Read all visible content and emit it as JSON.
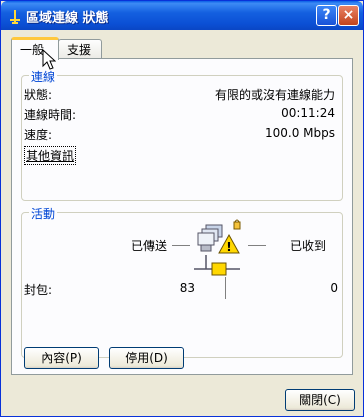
{
  "window": {
    "title": "區域連線 狀態",
    "help_glyph": "?",
    "close_glyph": "×"
  },
  "tabs": [
    {
      "label": "一般"
    },
    {
      "label": "支援"
    }
  ],
  "connection": {
    "group_title": "連線",
    "status_label": "狀態:",
    "status_value": "有限的或沒有連線能力",
    "duration_label": "連線時間:",
    "duration_value": "00:11:24",
    "speed_label": "速度:",
    "speed_value": "100.0 Mbps",
    "details_link": "其他資訊"
  },
  "activity": {
    "group_title": "活動",
    "sent_label": "已傳送",
    "received_label": "已收到",
    "packets_label": "封包:",
    "packets_sent": "83",
    "packets_received": "0"
  },
  "buttons": {
    "properties": "內容(P)",
    "disable": "停用(D)",
    "close": "關閉(C)"
  },
  "colors": {
    "title_bar": "#0a46c4",
    "group_title": "#0046d5",
    "warning": "#ffd700",
    "tab_highlight": "#ffc83c"
  }
}
